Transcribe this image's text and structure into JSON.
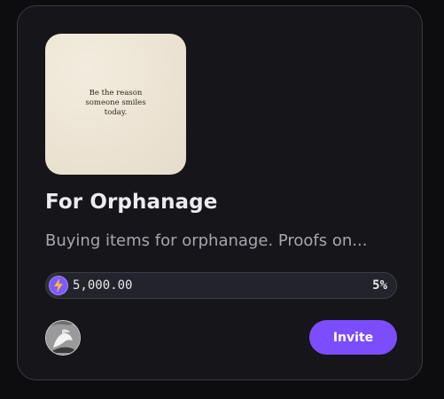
{
  "card": {
    "cover_text": "Be the reason\nsomeone smiles\ntoday.",
    "title": "For Orphanage",
    "description": "Buying items for orphanage. Proofs on...",
    "progress": {
      "amount": "5,000.00",
      "percent_label": "5%",
      "fraction": 0.05,
      "icon": "lightning-bolt-icon"
    },
    "invite_label": "Invite"
  },
  "colors": {
    "accent": "#7c4dff",
    "card_bg": "#15151a",
    "page_bg": "#0d0d10"
  }
}
